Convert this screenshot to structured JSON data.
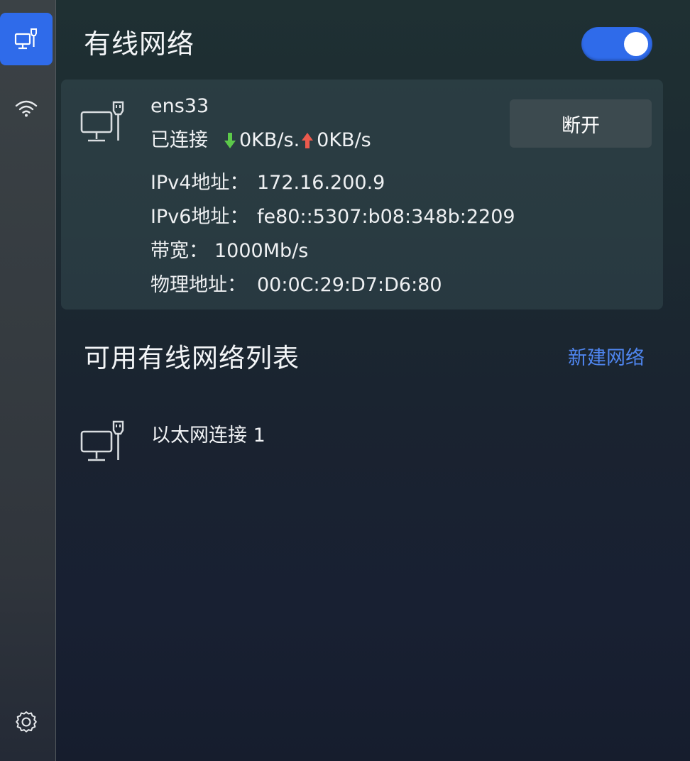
{
  "sidebar": {
    "items": [
      {
        "icon": "wired-network-icon",
        "active": true
      },
      {
        "icon": "wifi-icon",
        "active": false
      },
      {
        "icon": "gear-icon",
        "active": false
      }
    ]
  },
  "header": {
    "title": "有线网络",
    "toggle_on": true
  },
  "connection": {
    "name": "ens33",
    "status": "已连接",
    "download": "0KB/s.",
    "upload": "0KB/s",
    "ipv4_label": "IPv4地址：",
    "ipv4": "172.16.200.9",
    "ipv6_label": "IPv6地址：",
    "ipv6": "fe80::5307:b08:348b:2209",
    "bandwidth_label": "带宽：",
    "bandwidth": "1000Mb/s",
    "mac_label": "物理地址：",
    "mac": "00:0C:29:D7:D6:80",
    "disconnect_label": "断开"
  },
  "list": {
    "title": "可用有线网络列表",
    "new_label": "新建网络",
    "items": [
      {
        "label": "以太网连接 1"
      }
    ]
  },
  "colors": {
    "accent": "#2f6bea",
    "link": "#4f86f0",
    "download_arrow": "#5cc94a",
    "upload_arrow": "#ec5a4d"
  }
}
